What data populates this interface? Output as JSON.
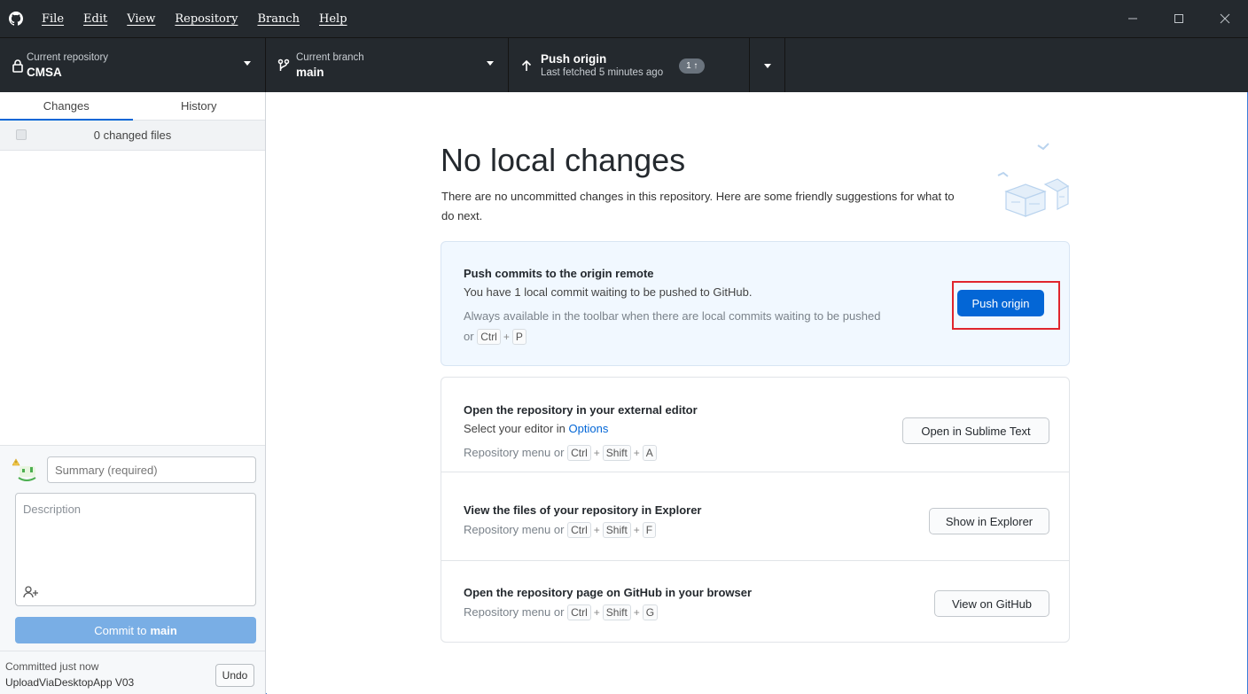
{
  "menu": [
    "File",
    "Edit",
    "View",
    "Repository",
    "Branch",
    "Help"
  ],
  "toolbar": {
    "repo": {
      "label": "Current repository",
      "value": "CMSA"
    },
    "branch": {
      "label": "Current branch",
      "value": "main"
    },
    "push": {
      "title": "Push origin",
      "subtitle": "Last fetched 5 minutes ago",
      "badge": "1 ↑"
    }
  },
  "sidebar": {
    "tabs": [
      "Changes",
      "History"
    ],
    "changed_files": "0 changed files",
    "summary_placeholder": "Summary (required)",
    "description_placeholder": "Description",
    "commit_prefix": "Commit to",
    "commit_branch": "main",
    "last_commit": {
      "title": "Committed just now",
      "message": "UploadViaDesktopApp V03",
      "undo": "Undo"
    }
  },
  "main": {
    "heading": "No local changes",
    "intro": "There are no uncommitted changes in this repository. Here are some friendly suggestions for what to do next.",
    "push_card": {
      "title": "Push commits to the origin remote",
      "line": "You have 1 local commit waiting to be pushed to GitHub.",
      "hint": "Always available in the toolbar when there are local commits waiting to be pushed",
      "hint_or": "or",
      "keys": [
        "Ctrl",
        "P"
      ],
      "button": "Push origin"
    },
    "editor_card": {
      "title": "Open the repository in your external editor",
      "line_prefix": "Select your editor in",
      "line_link": "Options",
      "hint": "Repository menu or",
      "keys": [
        "Ctrl",
        "Shift",
        "A"
      ],
      "button": "Open in Sublime Text"
    },
    "explorer_card": {
      "title": "View the files of your repository in Explorer",
      "hint": "Repository menu or",
      "keys": [
        "Ctrl",
        "Shift",
        "F"
      ],
      "button": "Show in Explorer"
    },
    "github_card": {
      "title": "Open the repository page on GitHub in your browser",
      "hint": "Repository menu or",
      "keys": [
        "Ctrl",
        "Shift",
        "G"
      ],
      "button": "View on GitHub"
    }
  },
  "colors": {
    "accent": "#0366d6",
    "toolbar": "#24292e",
    "highlight": "#e0252d"
  }
}
